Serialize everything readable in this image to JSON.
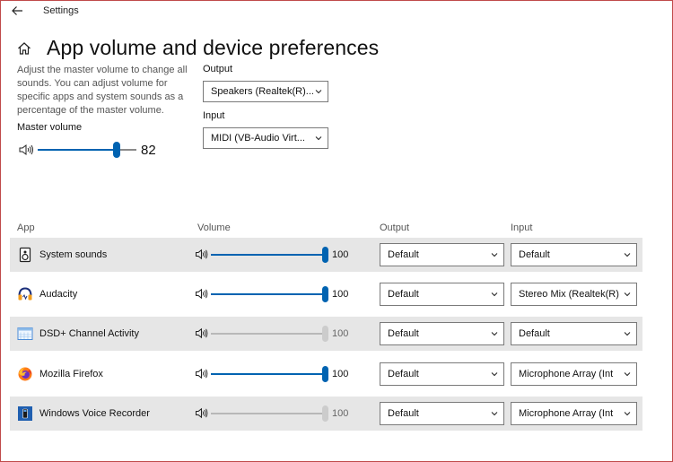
{
  "window": {
    "title": "Settings"
  },
  "header": {
    "title": "App volume and device preferences"
  },
  "description": "Adjust the master volume to change all sounds. You can adjust volume for specific apps and system sounds as a percentage of the master volume.",
  "master": {
    "label": "Master volume",
    "value": "82",
    "level": 0.82
  },
  "devices": {
    "output_label": "Output",
    "output_value": "Speakers (Realtek(R)...",
    "input_label": "Input",
    "input_value": "MIDI (VB-Audio Virt..."
  },
  "table": {
    "columns": {
      "app": "App",
      "volume": "Volume",
      "output": "Output",
      "input": "Input"
    },
    "rows": [
      {
        "name": "System sounds",
        "icon": "system-sounds-icon",
        "volume": "100",
        "level": 1.0,
        "enabled": true,
        "output": "Default",
        "input": "Default"
      },
      {
        "name": "Audacity",
        "icon": "audacity-icon",
        "volume": "100",
        "level": 1.0,
        "enabled": true,
        "output": "Default",
        "input": "Stereo Mix (Realtek(R)"
      },
      {
        "name": "DSD+ Channel Activity",
        "icon": "app-window-icon",
        "volume": "100",
        "level": 1.0,
        "enabled": false,
        "output": "Default",
        "input": "Default"
      },
      {
        "name": "Mozilla Firefox",
        "icon": "firefox-icon",
        "volume": "100",
        "level": 1.0,
        "enabled": true,
        "output": "Default",
        "input": "Microphone Array (Int"
      },
      {
        "name": "Windows Voice Recorder",
        "icon": "voice-recorder-icon",
        "volume": "100",
        "level": 1.0,
        "enabled": false,
        "output": "Default",
        "input": "Microphone Array (Int"
      }
    ]
  },
  "colors": {
    "accent": "#0063b1",
    "row_shade": "#e6e6e6",
    "disabled_thumb": "#cccccc"
  }
}
